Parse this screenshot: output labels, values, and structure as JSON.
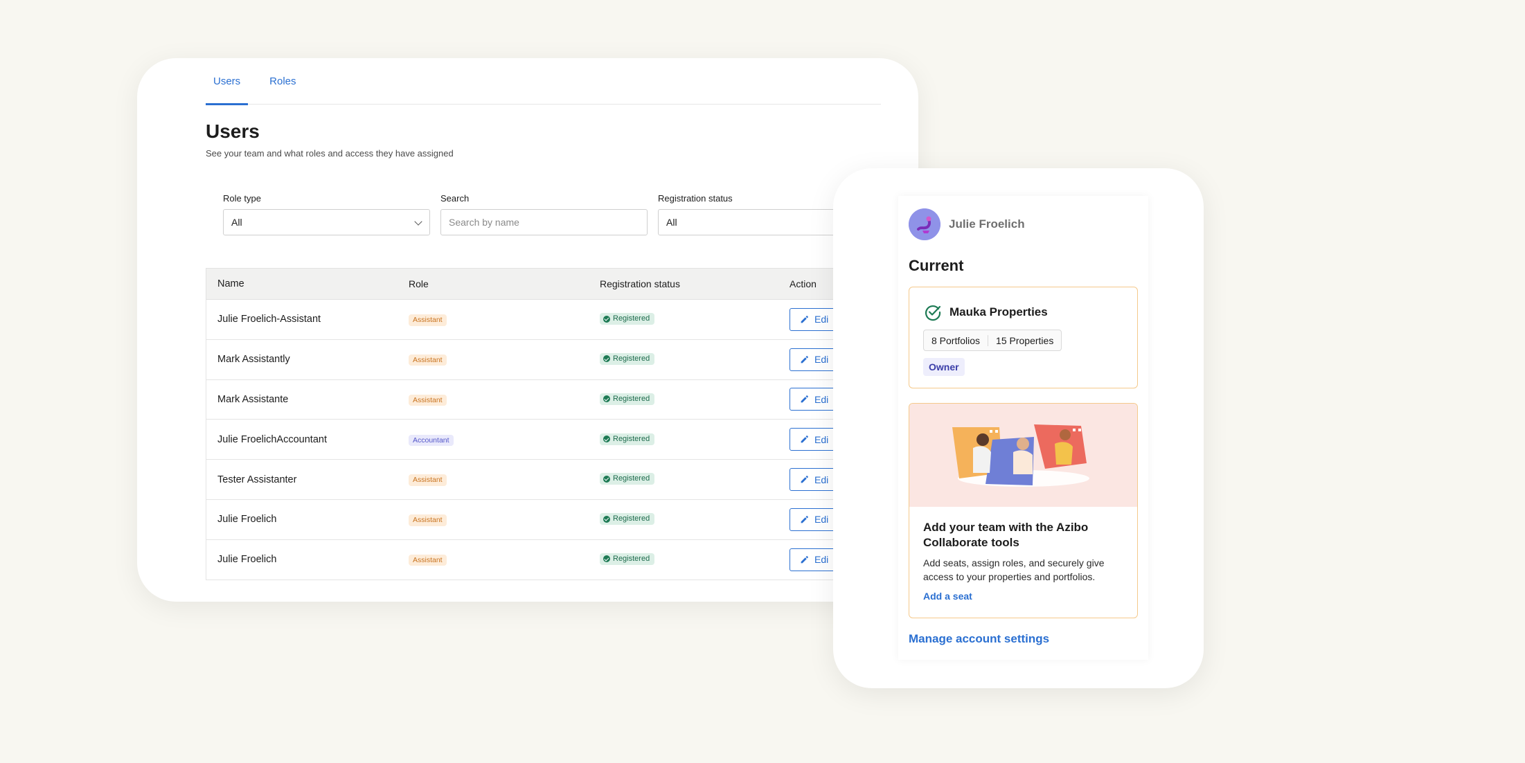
{
  "tabs": [
    {
      "label": "Users",
      "active": true
    },
    {
      "label": "Roles",
      "active": false
    }
  ],
  "page": {
    "title": "Users",
    "subtitle": "See your team and what roles and access they have assigned"
  },
  "filters": {
    "role_type": {
      "label": "Role type",
      "value": "All"
    },
    "search": {
      "label": "Search",
      "placeholder": "Search by name"
    },
    "registration_status": {
      "label": "Registration status",
      "value": "All"
    }
  },
  "table": {
    "headers": [
      "Name",
      "Role",
      "Registration status",
      "Action"
    ],
    "action_label": "Edi",
    "rows": [
      {
        "name": "Julie Froelich-Assistant",
        "role": "Assistant",
        "status": "Registered"
      },
      {
        "name": "Mark Assistantly",
        "role": "Assistant",
        "status": "Registered"
      },
      {
        "name": "Mark Assistante",
        "role": "Assistant",
        "status": "Registered"
      },
      {
        "name": "Julie FroelichAccountant",
        "role": "Accountant",
        "status": "Registered"
      },
      {
        "name": "Tester Assistanter",
        "role": "Assistant",
        "status": "Registered"
      },
      {
        "name": "Julie Froelich",
        "role": "Assistant",
        "status": "Registered"
      },
      {
        "name": "Julie Froelich",
        "role": "Assistant",
        "status": "Registered"
      }
    ]
  },
  "account": {
    "user_name": "Julie Froelich",
    "current_title": "Current",
    "org": {
      "name": "Mauka Properties",
      "portfolios": "8 Portfolios",
      "properties": "15 Properties",
      "role": "Owner"
    },
    "promo": {
      "title": "Add your team with the Azibo Collaborate tools",
      "body": "Add seats, assign roles, and securely give access to your properties and portfolios.",
      "link": "Add a seat"
    },
    "manage_link": "Manage account settings"
  },
  "colors": {
    "accent": "#2a6fd1",
    "background": "#f8f7f1",
    "assistant_badge": "#fdecd9",
    "accountant_badge": "#e9e9fb",
    "registered_badge": "#dcefe6",
    "card_border": "#f5c98b"
  }
}
